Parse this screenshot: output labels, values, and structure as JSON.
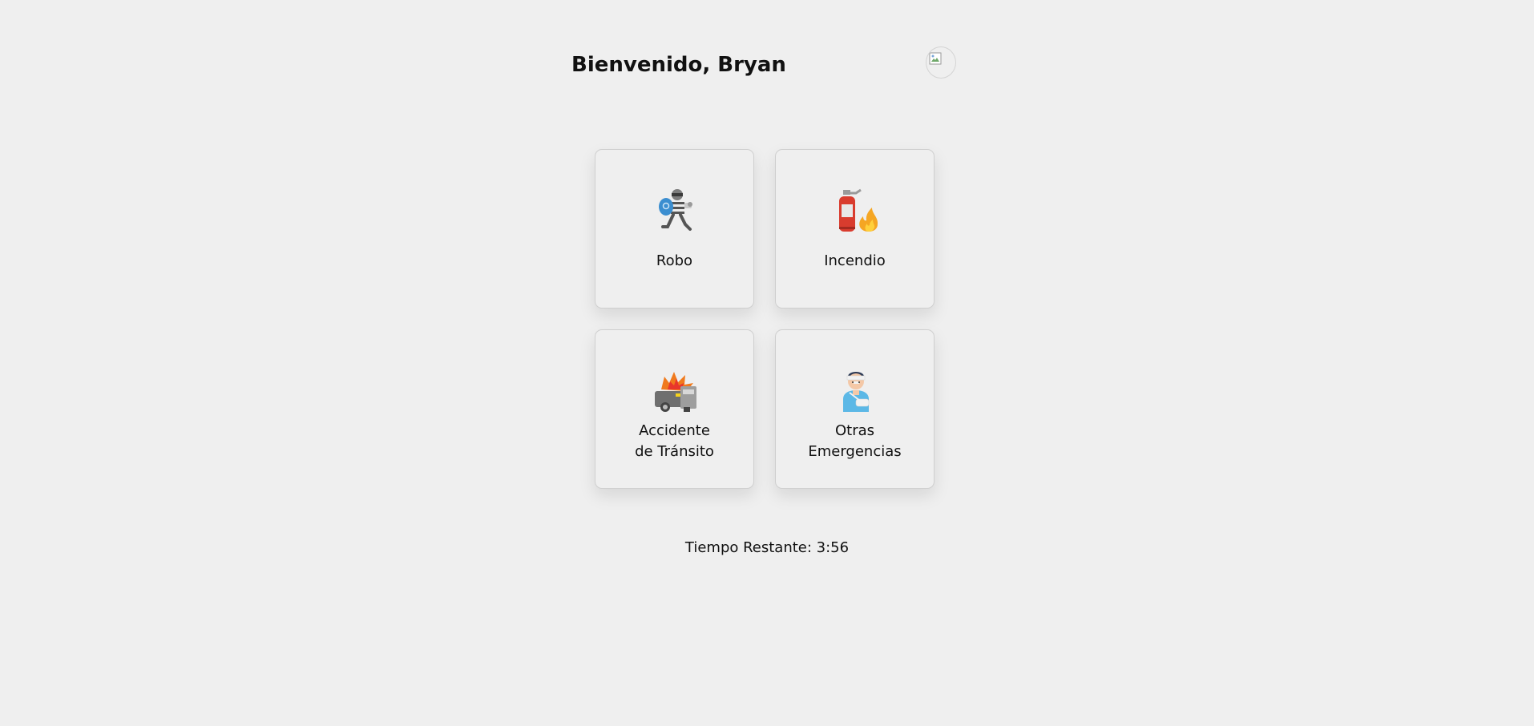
{
  "header": {
    "welcome_text": "Bienvenido, Bryan",
    "avatar_icon": "broken-image-icon"
  },
  "cards": [
    {
      "icon": "thief-icon",
      "label_line1": "Robo",
      "label_line2": ""
    },
    {
      "icon": "fire-extinguisher-icon",
      "label_line1": "Incendio",
      "label_line2": ""
    },
    {
      "icon": "car-accident-icon",
      "label_line1": "Accidente",
      "label_line2": "de Tránsito"
    },
    {
      "icon": "injured-person-icon",
      "label_line1": "Otras",
      "label_line2": "Emergencias"
    }
  ],
  "timer": {
    "text": "Tiempo Restante: 3:56"
  },
  "colors": {
    "background": "#efefef",
    "card_border": "#cfcfcf",
    "text": "#111111"
  }
}
